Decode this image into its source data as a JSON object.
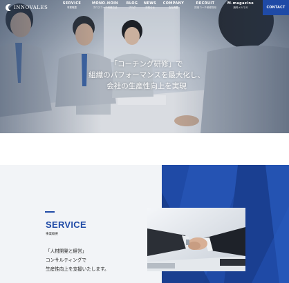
{
  "header": {
    "logo_text": "INNOVALES",
    "nav": [
      {
        "label": "SERVICE",
        "sub": "事業概要"
      },
      {
        "label": "MONO-HOIN",
        "sub": "ホロスコーチ研修方法"
      },
      {
        "label": "BLOG",
        "sub": "ブログ"
      },
      {
        "label": "NEWS",
        "sub": "お知らせ"
      },
      {
        "label": "COMPANY",
        "sub": "会社概要"
      },
      {
        "label": "RECRUIT",
        "sub": "採用コーチ研修採用"
      },
      {
        "label": "M-magazine",
        "sub": "無料メルマガ"
      }
    ],
    "contact_label": "CONTACT"
  },
  "hero": {
    "catch_lines": [
      "「コーチング研修」で",
      "組織のパフォーマンスを最大化し、",
      "会社の生産性向上を実現"
    ]
  },
  "service": {
    "title": "SERVICE",
    "subtitle": "事業概要",
    "description_lines": [
      "「人材開発と経営」",
      "コンサルティングで",
      "生産性向上を支援いたします。"
    ]
  },
  "colors": {
    "brand_blue": "#1f4aa6",
    "panel_gray": "#f2f4f7"
  },
  "icons": {
    "logo_mark": "crescent-swoosh-icon"
  }
}
